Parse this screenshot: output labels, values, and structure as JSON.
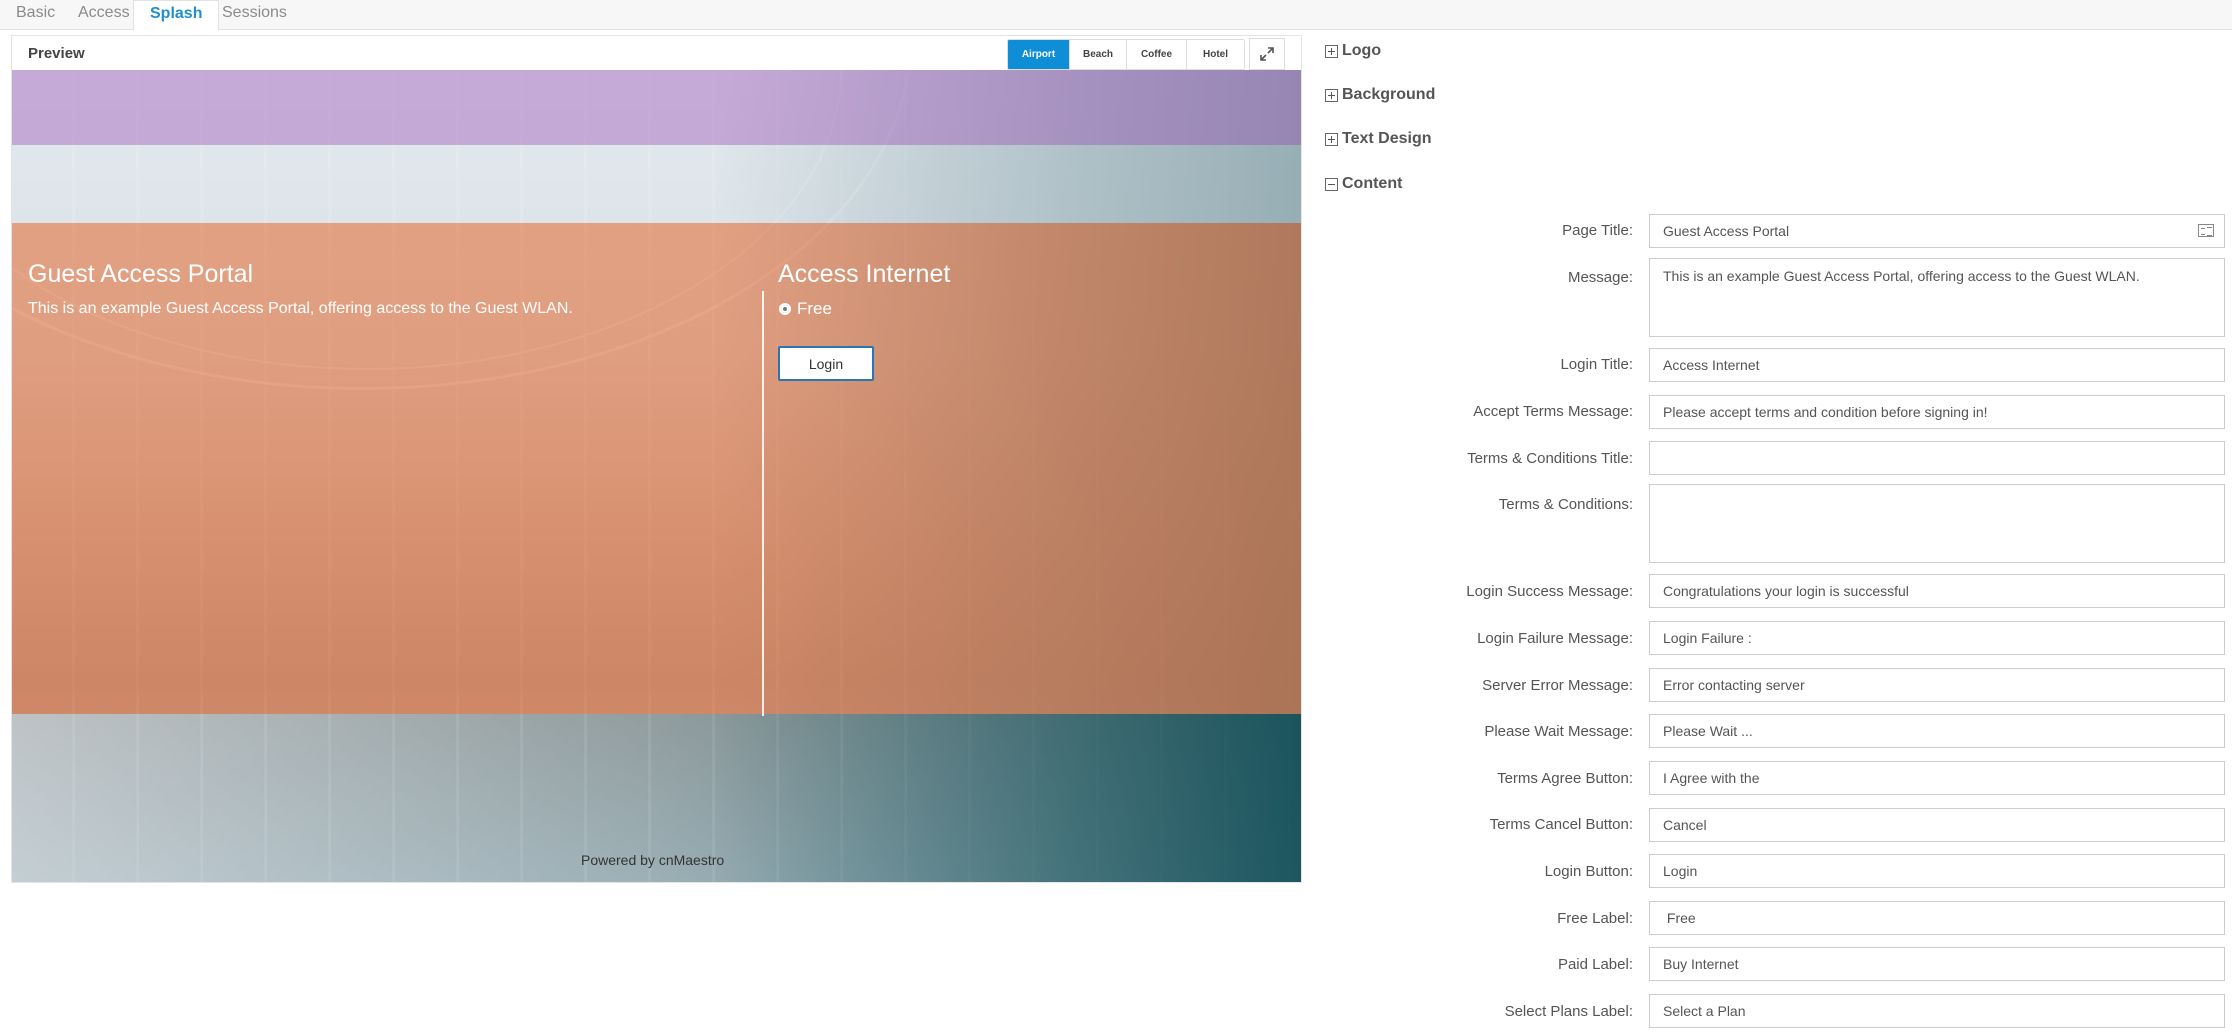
{
  "tabs": [
    {
      "label": "Basic",
      "active": false
    },
    {
      "label": "Access",
      "active": false
    },
    {
      "label": "Splash",
      "active": true
    },
    {
      "label": "Sessions",
      "active": false
    }
  ],
  "preview": {
    "title": "Preview",
    "themes": [
      "Airport",
      "Beach",
      "Coffee",
      "Hotel"
    ],
    "selected_theme": "Airport",
    "expand_icon": "expand-icon"
  },
  "splash": {
    "page_title": "Guest Access Portal",
    "message": "This is an example Guest Access Portal, offering access to the Guest WLAN.",
    "login_title": "Access Internet",
    "free_label": "Free",
    "login_button": "Login",
    "powered_by": "Powered by cnMaestro"
  },
  "sections": {
    "logo": "Logo",
    "background": "Background",
    "text_design": "Text Design",
    "content": "Content"
  },
  "content_fields": {
    "page_title": {
      "label": "Page Title:",
      "value": "Guest Access Portal"
    },
    "message": {
      "label": "Message:",
      "value": "This is an example Guest Access Portal, offering access to the Guest WLAN."
    },
    "login_title": {
      "label": "Login Title:",
      "value": "Access Internet"
    },
    "accept_terms": {
      "label": "Accept Terms Message:",
      "value": "Please accept terms and condition before signing in!"
    },
    "terms_title": {
      "label": "Terms & Conditions Title:",
      "value": ""
    },
    "terms": {
      "label": "Terms & Conditions:",
      "value": ""
    },
    "login_success": {
      "label": "Login Success Message:",
      "value": "Congratulations your login is successful"
    },
    "login_failure": {
      "label": "Login Failure Message:",
      "value": "Login Failure :"
    },
    "server_error": {
      "label": "Server Error Message:",
      "value": "Error contacting server"
    },
    "please_wait": {
      "label": "Please Wait Message:",
      "value": "Please Wait ..."
    },
    "terms_agree": {
      "label": "Terms Agree Button:",
      "value": "I Agree with the"
    },
    "terms_cancel": {
      "label": "Terms Cancel Button:",
      "value": "Cancel"
    },
    "login_button": {
      "label": "Login Button:",
      "value": "Login"
    },
    "free_label": {
      "label": "Free Label:",
      "value": " Free"
    },
    "paid_label": {
      "label": "Paid Label:",
      "value": "Buy Internet"
    },
    "select_plans": {
      "label": "Select Plans Label:",
      "value": "Select a Plan"
    }
  },
  "colors": {
    "accent": "#1f8fd0",
    "theme_active": "#0f8ed8",
    "band_top": "#be96d2",
    "band_main": "#ec875a"
  }
}
